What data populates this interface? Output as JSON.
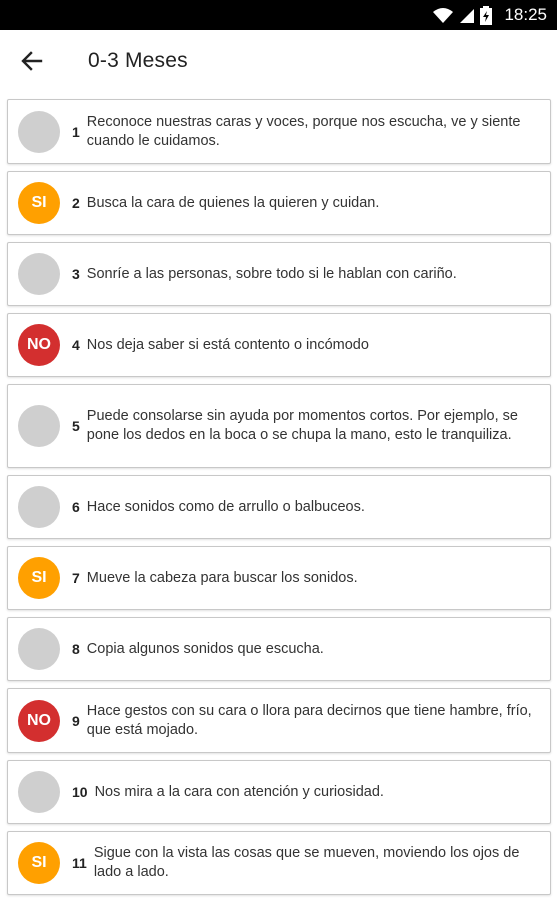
{
  "status_bar": {
    "time": "18:25",
    "icons": [
      "wifi-icon",
      "signal-icon",
      "battery-icon"
    ]
  },
  "app_bar": {
    "back_icon": "arrow-left-icon",
    "title": "0-3 Meses"
  },
  "colors": {
    "si": "#FFA000",
    "no": "#D32F2F",
    "empty": "#CFCFCF"
  },
  "items": [
    {
      "number": "1",
      "status": "",
      "text": "Reconoce nuestras caras y voces, porque nos escucha, ve y siente cuando le cuidamos."
    },
    {
      "number": "2",
      "status": "SI",
      "text": "Busca la cara de quienes la quieren y cuidan."
    },
    {
      "number": "3",
      "status": "",
      "text": "Sonríe a las personas, sobre todo si le hablan con cariño."
    },
    {
      "number": "4",
      "status": "NO",
      "text": "Nos deja saber si está contento o incómodo"
    },
    {
      "number": "5",
      "status": "",
      "text": "Puede consolarse sin ayuda por momentos cortos. Por ejemplo, se pone los dedos en la boca o se chupa la mano, esto le tranquiliza."
    },
    {
      "number": "6",
      "status": "",
      "text": "Hace sonidos como de arrullo o balbuceos."
    },
    {
      "number": "7",
      "status": "SI",
      "text": "Mueve la cabeza para buscar los sonidos."
    },
    {
      "number": "8",
      "status": "",
      "text": "Copia algunos sonidos que escucha."
    },
    {
      "number": "9",
      "status": "NO",
      "text": "Hace gestos con su cara o llora para decirnos que tiene hambre, frío, que está mojado."
    },
    {
      "number": "10",
      "status": "",
      "text": "Nos mira a la cara con atención y curiosidad."
    },
    {
      "number": "11",
      "status": "SI",
      "text": "Sigue con la vista las cosas que se mueven, moviendo los ojos de lado a lado."
    }
  ]
}
